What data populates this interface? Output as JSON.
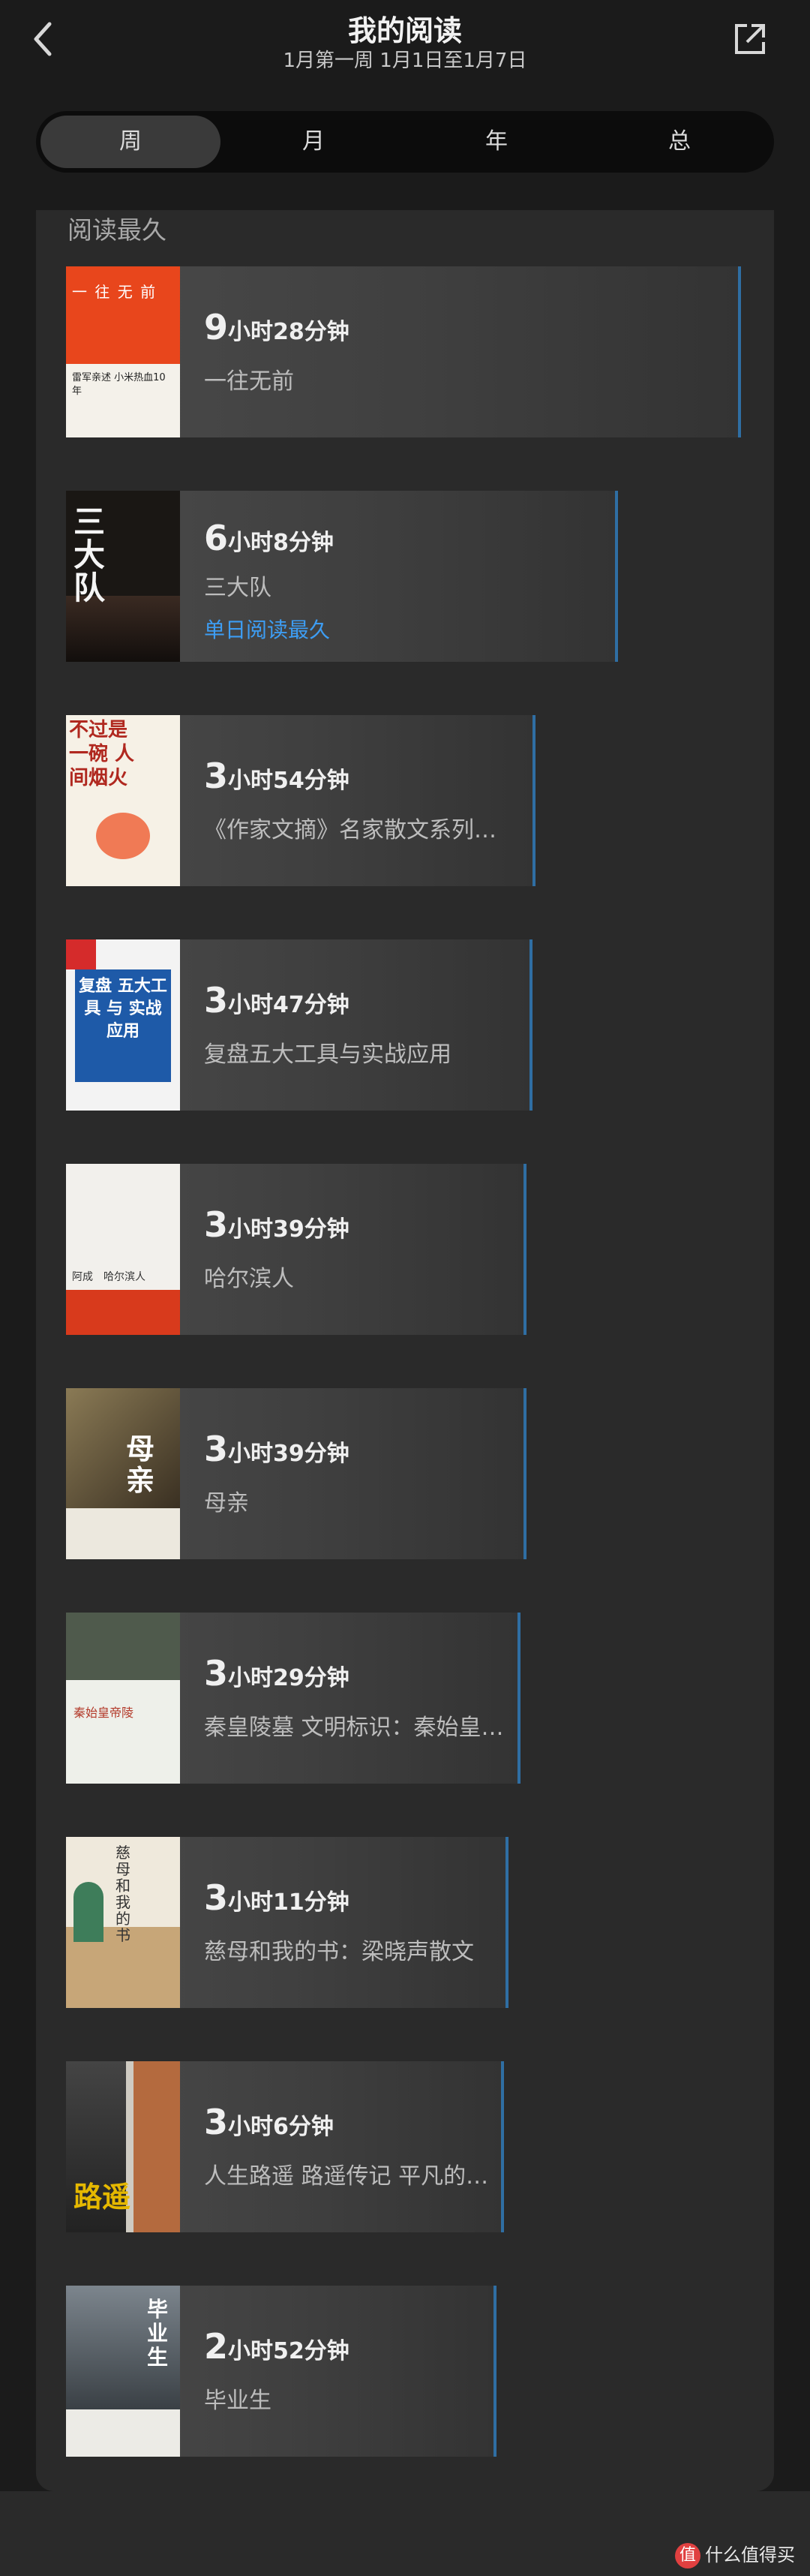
{
  "header": {
    "title": "我的阅读",
    "subtitle": "1月第一周 1月1日至1月7日",
    "back_icon": "chevron-left-icon",
    "share_icon": "share-external-icon"
  },
  "tabs": [
    {
      "label": "周",
      "active": true
    },
    {
      "label": "月",
      "active": false
    },
    {
      "label": "年",
      "active": false
    },
    {
      "label": "总",
      "active": false
    }
  ],
  "section": {
    "title": "阅读最久"
  },
  "books": [
    {
      "hours": "9",
      "rest": "小时28分钟",
      "name": "一往无前",
      "tag": "",
      "cover_title": "一 往 无 前",
      "cover_sub": "雷军亲述 小米热血10年"
    },
    {
      "hours": "6",
      "rest": "小时8分钟",
      "name": "三大队",
      "tag": "单日阅读最久",
      "cover_title": "三大队",
      "cover_sub": ""
    },
    {
      "hours": "3",
      "rest": "小时54分钟",
      "name": "《作家文摘》名家散文系列：不过是一碗人间烟火",
      "tag": "",
      "cover_title": "不过是 一碗 人间烟火",
      "cover_sub": ""
    },
    {
      "hours": "3",
      "rest": "小时47分钟",
      "name": "复盘五大工具与实战应用",
      "tag": "",
      "cover_title": "复盘 五大工具 与 实战应用",
      "cover_sub": ""
    },
    {
      "hours": "3",
      "rest": "小时39分钟",
      "name": "哈尔滨人",
      "tag": "",
      "cover_title": "阿成　哈尔滨人",
      "cover_sub": ""
    },
    {
      "hours": "3",
      "rest": "小时39分钟",
      "name": "母亲",
      "tag": "",
      "cover_title": "母亲",
      "cover_sub": ""
    },
    {
      "hours": "3",
      "rest": "小时29分钟",
      "name": "秦皇陵墓 文明标识：秦始皇帝陵",
      "tag": "",
      "cover_title": "秦始皇帝陵",
      "cover_sub": ""
    },
    {
      "hours": "3",
      "rest": "小时11分钟",
      "name": "慈母和我的书：梁晓声散文",
      "tag": "",
      "cover_title": "慈母和我的书",
      "cover_sub": ""
    },
    {
      "hours": "3",
      "rest": "小时6分钟",
      "name": "人生路遥 路遥传记 平凡的世界",
      "tag": "",
      "cover_title": "路遥",
      "cover_sub": ""
    },
    {
      "hours": "2",
      "rest": "小时52分钟",
      "name": "毕业生",
      "tag": "",
      "cover_title": "毕业生",
      "cover_sub": ""
    }
  ],
  "watermark": {
    "icon_text": "值",
    "text": "什么值得买"
  },
  "colors": {
    "accent": "#3d9df3",
    "bar_edge": "#2f6ea3",
    "background": "#1b1b1b"
  }
}
